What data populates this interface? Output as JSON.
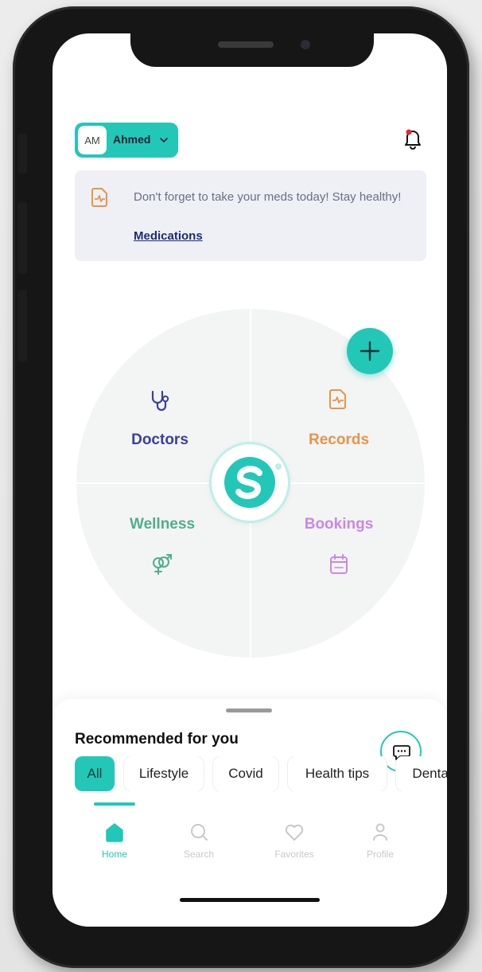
{
  "header": {
    "avatar_initials": "AM",
    "user_name": "Ahmed"
  },
  "reminder": {
    "message": "Don't forget to take your meds today! Stay healthy!",
    "link_label": "Medications"
  },
  "wheel": {
    "doctors": "Doctors",
    "records": "Records",
    "wellness": "Wellness",
    "bookings": "Bookings",
    "add_icon": "plus-icon",
    "logo_icon": "app-logo-s"
  },
  "recommended": {
    "title": "Recommended for you",
    "chips": [
      "All",
      "Lifestyle",
      "Covid",
      "Health tips",
      "Dental"
    ],
    "active_chip": "All"
  },
  "tabbar": {
    "tabs": [
      "Home",
      "Search",
      "Favorites",
      "Profile"
    ],
    "active": "Home"
  },
  "colors": {
    "accent": "#23c7b8",
    "doctors": "#3b3f9e",
    "records": "#e8944a",
    "wellness": "#4fae8d",
    "bookings": "#c889e6",
    "link": "#1a2a7a"
  }
}
